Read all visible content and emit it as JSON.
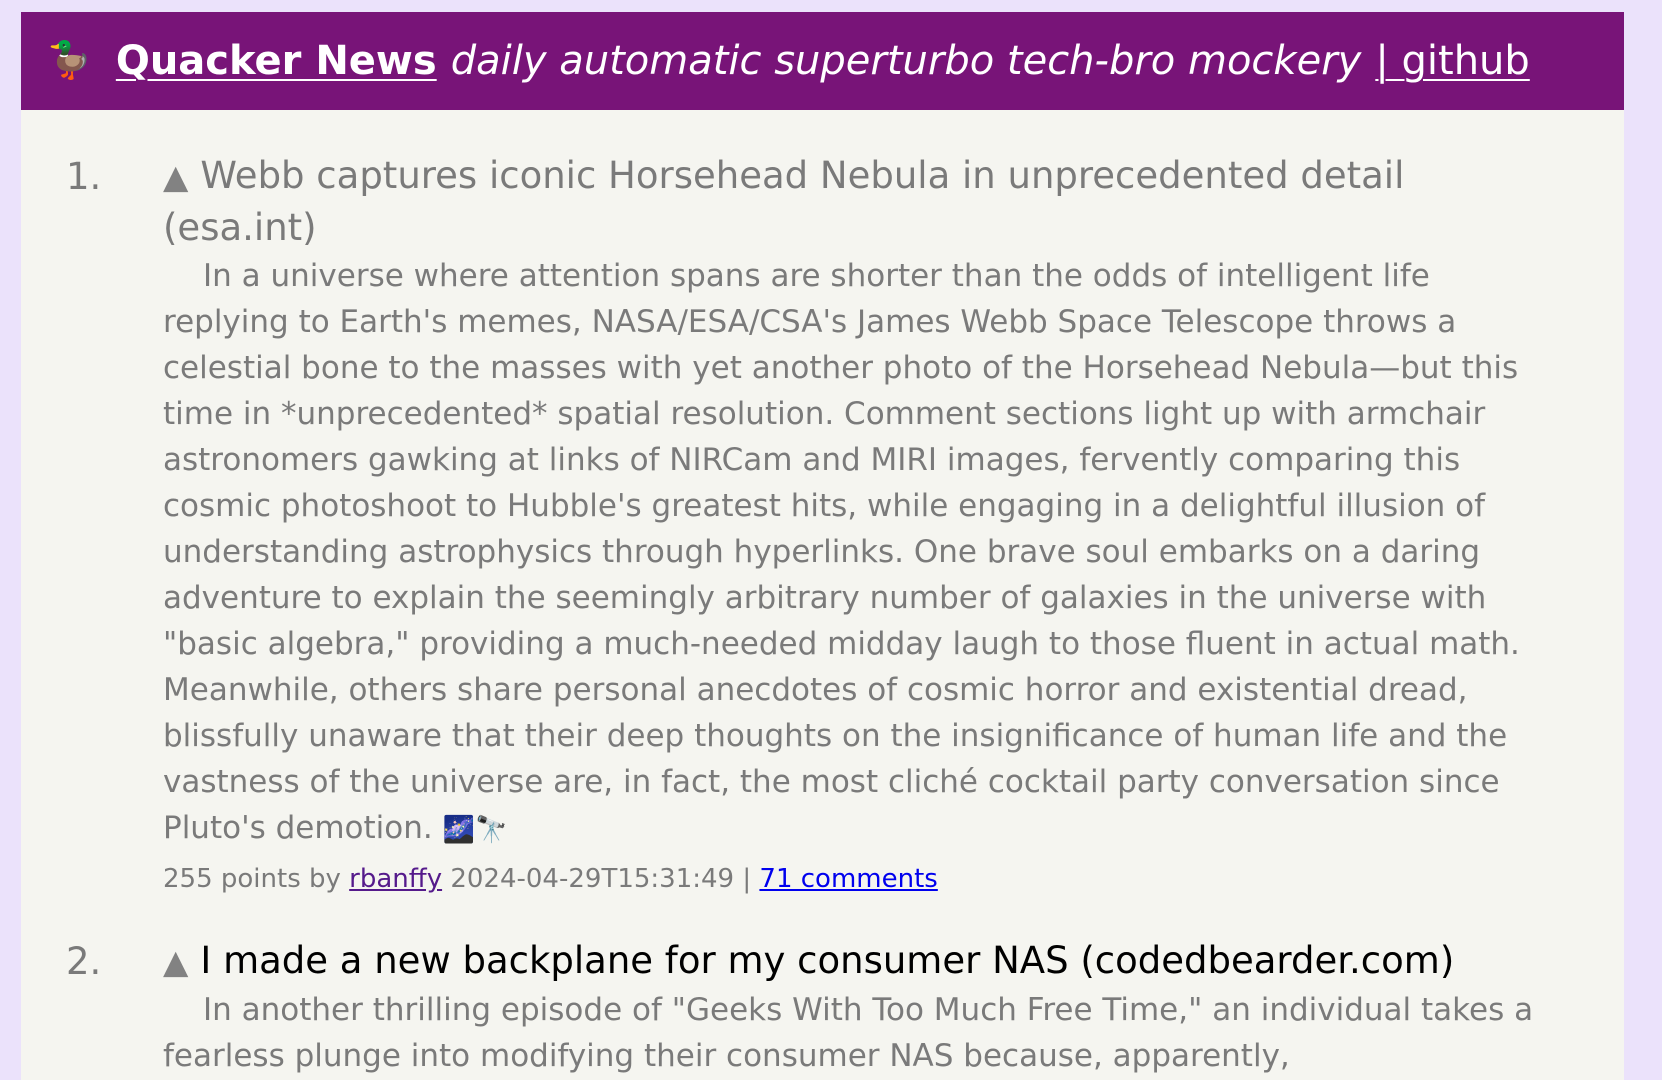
{
  "header": {
    "logo_emoji": "🦆",
    "site_title": "Quacker News",
    "tagline": "daily automatic superturbo tech-bro mockery",
    "github_link": "| github",
    "background_color": "#781478"
  },
  "stories": [
    {
      "rank": "1.",
      "upvote_icon": "▲",
      "title": "Webb captures iconic Horsehead Nebula in unprecedented detail",
      "domain": "(esa.int)",
      "summary": "In a universe where attention spans are shorter than the odds of intelligent life replying to Earth's memes, NASA/ESA/CSA's James Webb Space Telescope throws a celestial bone to the masses with yet another photo of the Horsehead Nebula—but this time in *unprecedented* spatial resolution. Comment sections light up with armchair astronomers gawking at links of NIRCam and MIRI images, fervently comparing this cosmic photoshoot to Hubble's greatest hits, while engaging in a delightful illusion of understanding astrophysics through hyperlinks. One brave soul embarks on a daring adventure to explain the seemingly arbitrary number of galaxies in the universe with \"basic algebra,\" providing a much-needed midday laugh to those fluent in actual math. Meanwhile, others share personal anecdotes of cosmic horror and existential dread, blissfully unaware that their deep thoughts on the insignificance of human life and the vastness of the universe are, in fact, the most cliché cocktail party conversation since Pluto's demotion.",
      "summary_emoji": "🌌🔭",
      "points_text": "255 points by",
      "user": "rbanffy",
      "timestamp": "2024-04-29T15:31:49",
      "separator": "|",
      "comments": "71 comments",
      "visited": true
    },
    {
      "rank": "2.",
      "upvote_icon": "▲",
      "title": "I made a new backplane for my consumer NAS",
      "domain": "(codedbearder.com)",
      "summary": "In another thrilling episode of \"Geeks With Too Much Free Time,\" an individual takes a fearless plunge into modifying their consumer NAS because, apparently,",
      "visited": false
    }
  ]
}
